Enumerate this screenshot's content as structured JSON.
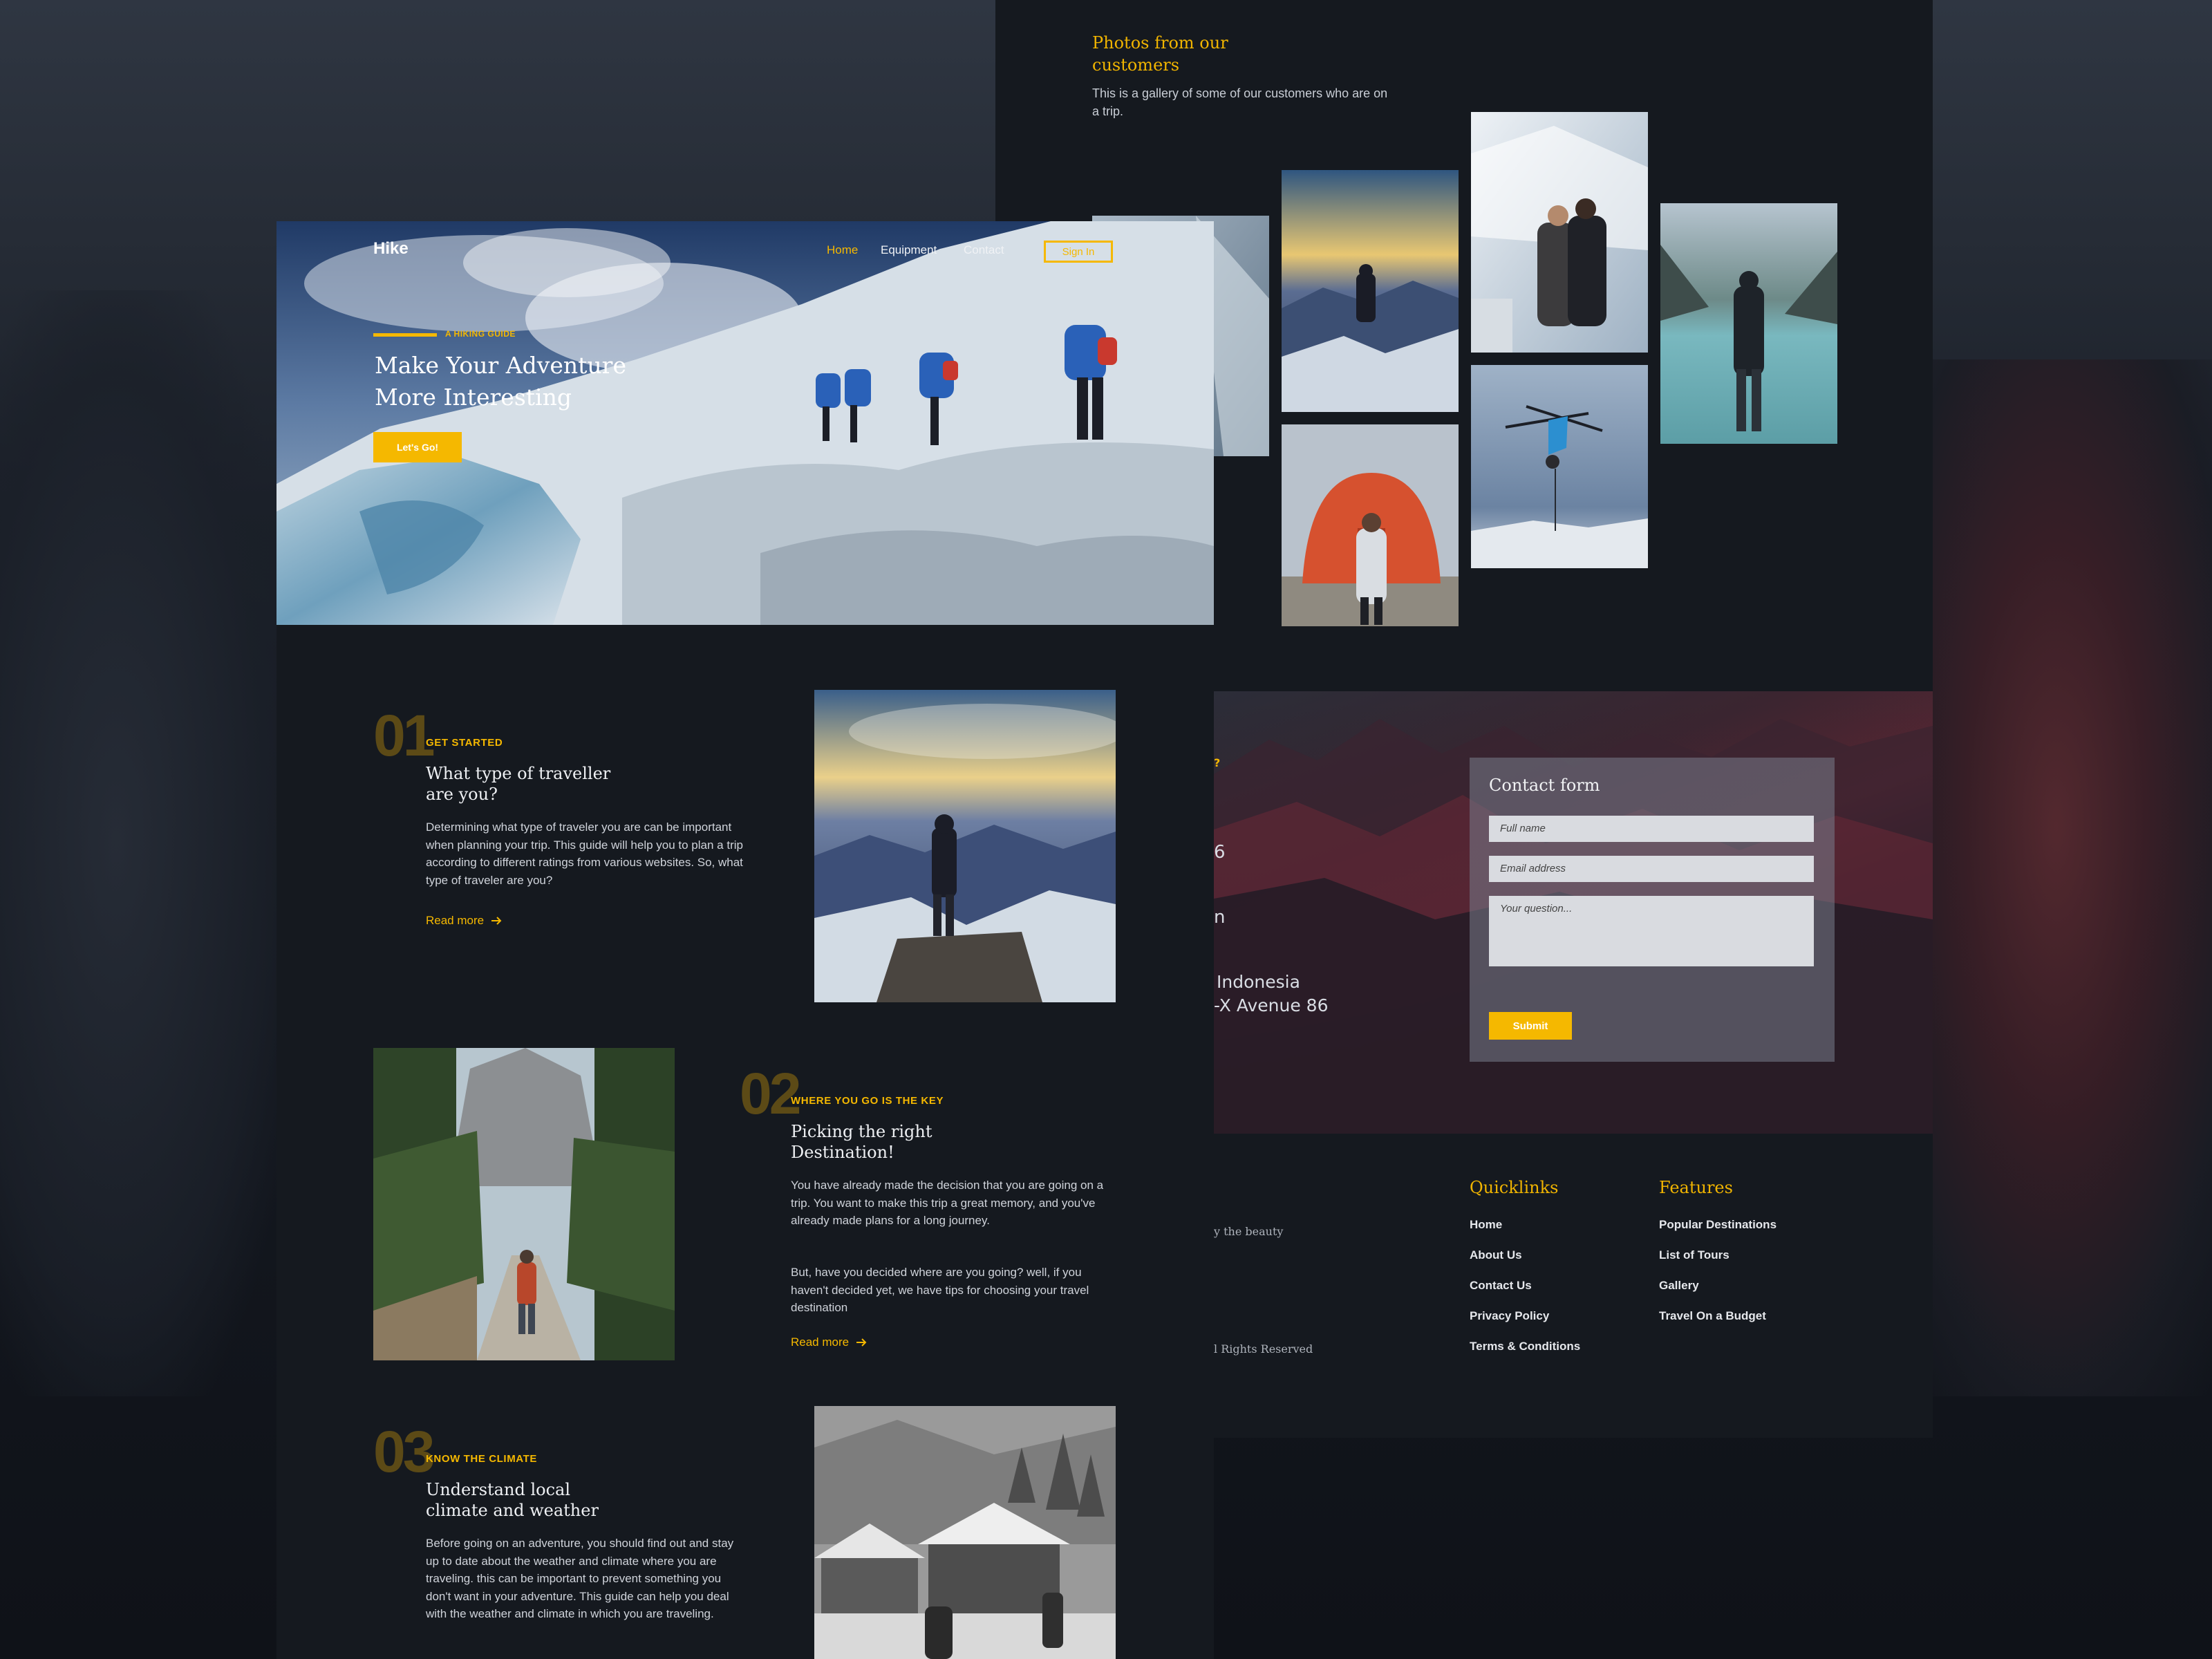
{
  "gallery": {
    "title": "Photos from our customers",
    "subtitle": "This is a gallery of some of our customers who are on a trip."
  },
  "contact": {
    "partial_label": "?",
    "partial_lines": [
      "6",
      "n",
      "Indonesia",
      "-X Avenue 86"
    ],
    "form_title": "Contact form",
    "full_name_placeholder": "Full name",
    "email_placeholder": "Email address",
    "question_placeholder": "Your question...",
    "submit_label": "Submit"
  },
  "footer": {
    "partial_text_1": "y the beauty",
    "partial_text_2": "l Rights Reserved",
    "quicklinks_title": "Quicklinks",
    "quicklinks": [
      "Home",
      "About Us",
      "Contact Us",
      "Privacy Policy",
      "Terms & Conditions"
    ],
    "features_title": "Features",
    "features": [
      "Popular Destinations",
      "List of Tours",
      "Gallery",
      "Travel On a Budget"
    ]
  },
  "header": {
    "logo": "Hike",
    "nav": [
      "Home",
      "Equipment",
      "Contact"
    ],
    "signin_label": "Sign In"
  },
  "hero": {
    "kicker": "A HIKING GUIDE",
    "title": "Make Your Adventure More Interesting",
    "cta_label": "Let's Go!"
  },
  "steps": [
    {
      "number": "01",
      "kicker": "GET STARTED",
      "title": "What type of traveller are you?",
      "body": "Determining what type of traveler you are can be important when planning your trip. This guide will help you to plan a trip according to different ratings from various websites. So, what type of traveler are you?",
      "link": "Read more"
    },
    {
      "number": "02",
      "kicker": "WHERE YOU GO IS THE KEY",
      "title": "Picking the right Destination!",
      "body": "You have already made the decision that you are going on a trip. You want to make this trip a great memory, and you've already made plans for a long journey.",
      "body2": "But, have you decided where are you going? well, if you haven't decided yet, we have tips for choosing your travel destination",
      "link": "Read more"
    },
    {
      "number": "03",
      "kicker": "KNOW THE CLIMATE",
      "title": "Understand local climate and weather",
      "body": "Before going on an adventure, you should find out and stay up to date about the weather and climate where you are traveling. this can be important to prevent something you don't want in your adventure. This guide can help you deal with the weather and climate in which you are traveling."
    }
  ],
  "colors": {
    "accent": "#f5b800",
    "panel": "#15191f"
  }
}
